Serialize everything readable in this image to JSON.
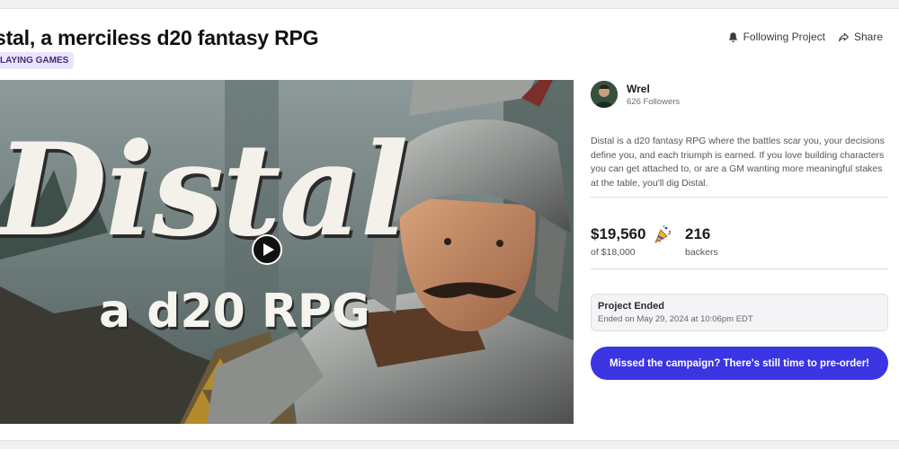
{
  "project": {
    "title": "stal, a merciless d20 fantasy RPG",
    "category": "LAYING GAMES"
  },
  "actions": {
    "follow_label": "Following Project",
    "share_label": "Share"
  },
  "video": {
    "title_art_line1": "Distal",
    "title_art_line2": "a d20 RPG"
  },
  "creator": {
    "name": "Wrel",
    "followers": "626 Followers"
  },
  "description": "Distal is a d20 fantasy RPG where the battles scar you, your decisions define you, and each triumph is earned. If you love building characters you can get attached to, or are a GM wanting more meaningful stakes at the table, you'll dig Distal.",
  "stats": {
    "pledged": "$19,560",
    "goal": "of $18,000",
    "backers_count": "216",
    "backers_label": "backers"
  },
  "status": {
    "title": "Project Ended",
    "ended_on": "Ended on May 29, 2024 at 10:06pm EDT"
  },
  "cta_label": "Missed the campaign? There's still time to pre-order!",
  "colors": {
    "accent": "#3a34e3",
    "category_bg": "#ece4ff"
  }
}
